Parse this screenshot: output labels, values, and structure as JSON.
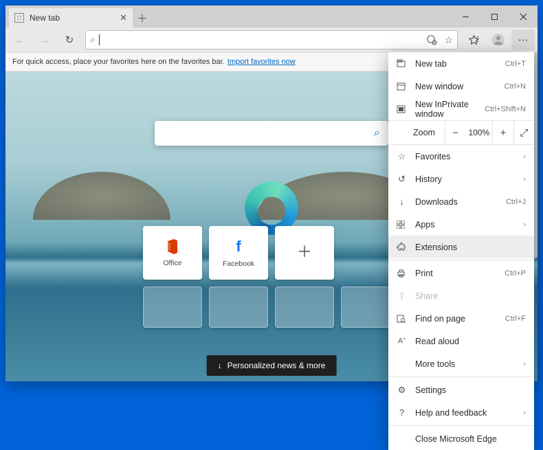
{
  "tab": {
    "title": "New tab"
  },
  "favbar": {
    "text": "For quick access, place your favorites here on the favorites bar.",
    "link": "Import favorites now"
  },
  "tiles": {
    "office": "Office",
    "facebook": "Facebook"
  },
  "newsbar": "Personalized news & more",
  "menu": {
    "newtab": {
      "label": "New tab",
      "shortcut": "Ctrl+T"
    },
    "newwin": {
      "label": "New window",
      "shortcut": "Ctrl+N"
    },
    "inpriv": {
      "label": "New InPrivate window",
      "shortcut": "Ctrl+Shift+N"
    },
    "zoom": {
      "label": "Zoom",
      "value": "100%"
    },
    "fav": {
      "label": "Favorites"
    },
    "hist": {
      "label": "History"
    },
    "dl": {
      "label": "Downloads",
      "shortcut": "Ctrl+J"
    },
    "apps": {
      "label": "Apps"
    },
    "ext": {
      "label": "Extensions"
    },
    "print": {
      "label": "Print",
      "shortcut": "Ctrl+P"
    },
    "share": {
      "label": "Share"
    },
    "find": {
      "label": "Find on page",
      "shortcut": "Ctrl+F"
    },
    "read": {
      "label": "Read aloud"
    },
    "more": {
      "label": "More tools"
    },
    "settings": {
      "label": "Settings"
    },
    "help": {
      "label": "Help and feedback"
    },
    "close": {
      "label": "Close Microsoft Edge"
    }
  }
}
